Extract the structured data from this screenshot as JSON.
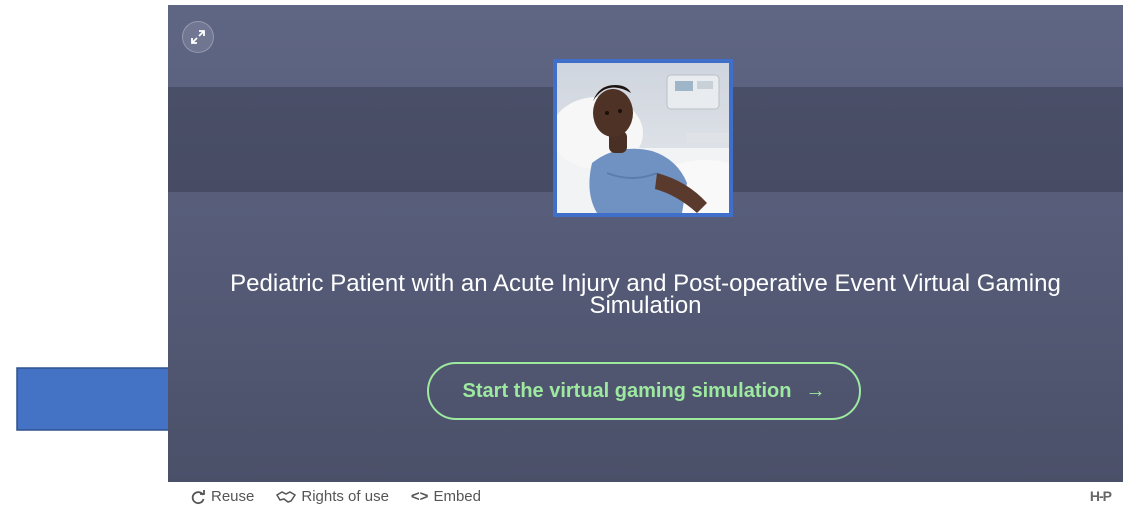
{
  "content": {
    "title": "Pediatric Patient with an Acute Injury and Post-operative Event Virtual Gaming Simulation",
    "start_button_label": "Start the virtual gaming simulation",
    "start_button_arrow": "→"
  },
  "footer": {
    "reuse_label": "Reuse",
    "rights_label": "Rights of use",
    "embed_symbol": "<>",
    "embed_label": "Embed",
    "logo_text": "H-P"
  },
  "icons": {
    "fullscreen": "expand-icon",
    "reuse": "refresh-icon",
    "rights": "handshake-icon",
    "embed": "code-icon",
    "callout": "arrow-right-icon"
  },
  "colors": {
    "accent_green": "#9de9a0",
    "frame_blue": "#3f6fc8",
    "callout_arrow": "#4472c4"
  }
}
